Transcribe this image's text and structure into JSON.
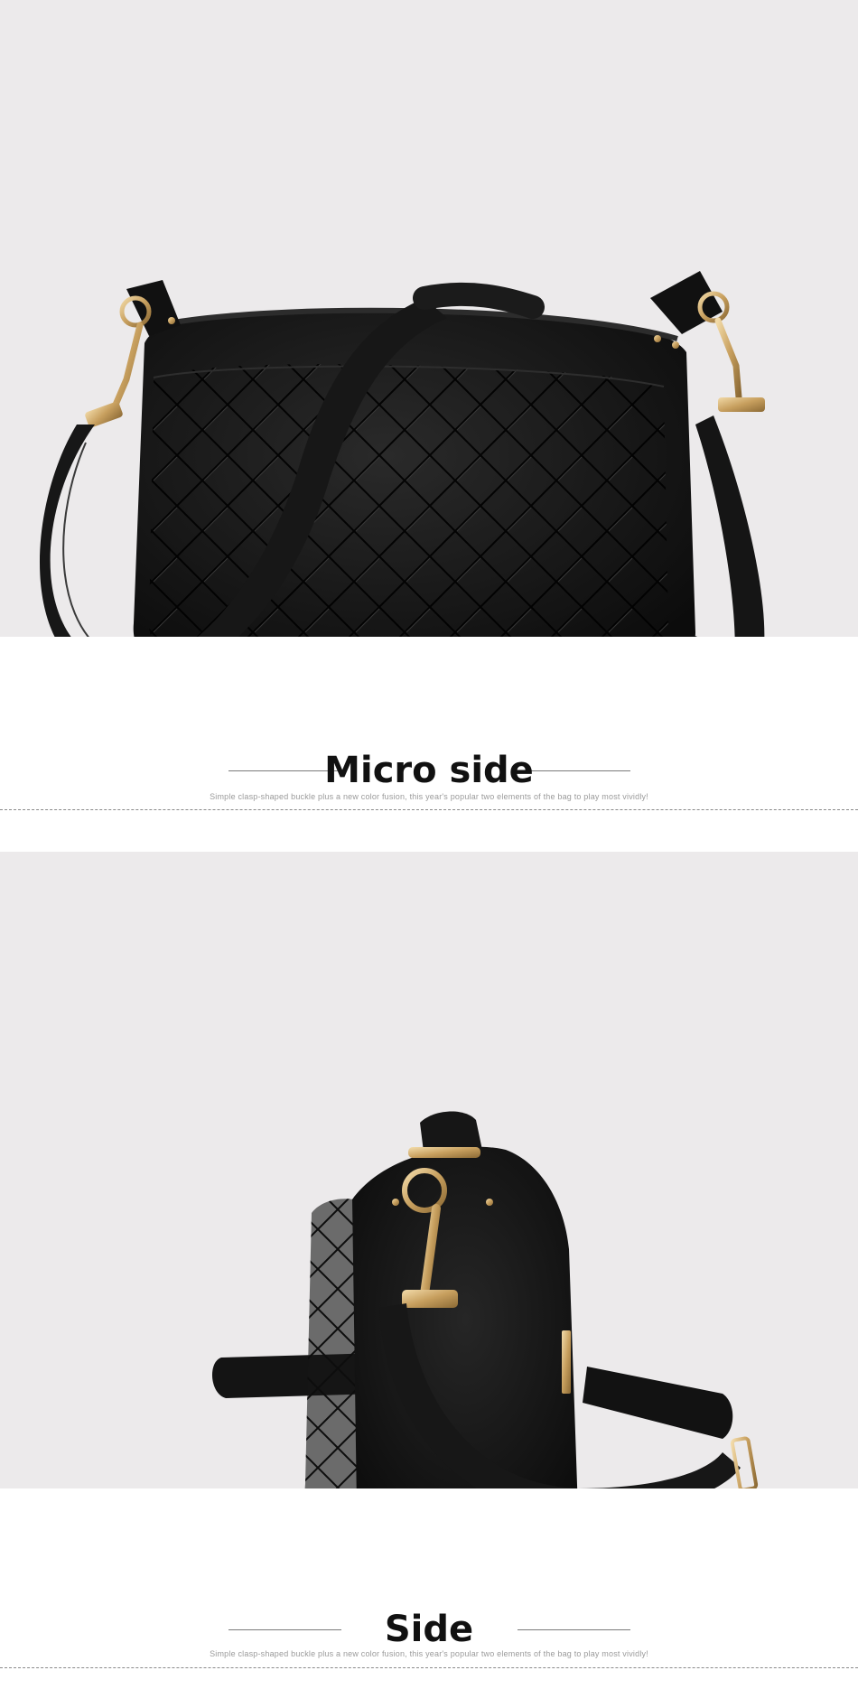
{
  "sections": [
    {
      "title": "Micro side",
      "subtitle": "Simple clasp-shaped buckle plus a new color fusion, this year's popular two elements of the bag to play most vividly!"
    },
    {
      "title": "Side",
      "subtitle": "Simple clasp-shaped buckle plus a new color fusion, this year's popular two elements of the bag to play most vividly!"
    }
  ],
  "colors": {
    "background": "#eceaeb",
    "bag": "#141414",
    "hardware": "#c9a46a"
  }
}
